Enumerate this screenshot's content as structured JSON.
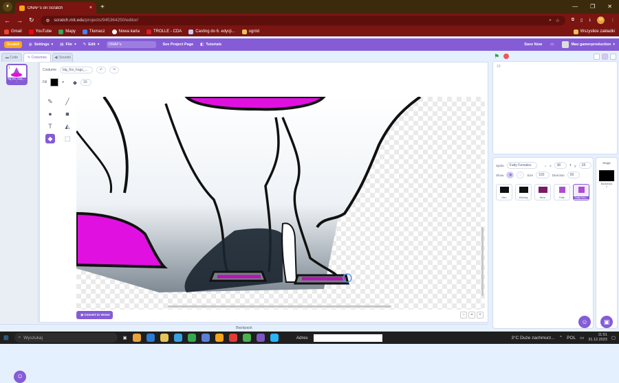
{
  "browser": {
    "tab_title": "ONAF's on Scratch",
    "tab_close": "×",
    "new_tab": "+",
    "win_min": "—",
    "win_max": "❐",
    "win_close": "✕",
    "url_host": "scratch.mit.edu",
    "url_path": "/projects/945364250/editor/",
    "profile_initial": "M",
    "bookmarks": [
      {
        "label": "Gmail"
      },
      {
        "label": "YouTube"
      },
      {
        "label": "Mapy"
      },
      {
        "label": "Tłumacz"
      },
      {
        "label": "Nowa karta"
      },
      {
        "label": "TROLLE - CDA"
      },
      {
        "label": "Casting do 6. edycji..."
      },
      {
        "label": "ogród"
      }
    ],
    "all_bookmarks": "Wszystkie zakładki"
  },
  "scratch": {
    "logo": "Scratch",
    "settings": "Settings",
    "file": "File",
    "edit": "Edit",
    "project_title": "ONAF's",
    "see_project_page": "See Project Page",
    "tutorials": "Tutorials",
    "save_now": "Save Now",
    "username": "Mao gamerproduction"
  },
  "editor": {
    "tabs": [
      {
        "label": "Code"
      },
      {
        "label": "Costumes"
      },
      {
        "label": "Sounds"
      }
    ],
    "costume_label": "Costume",
    "costume_name": "big_fox_hugs_...",
    "fill_label": "Fill",
    "outline_size": "15",
    "convert_button": "Convert to Vector",
    "costumes": [
      {
        "num": "1",
        "name": "big_fox_hugs_...",
        "size": "..."
      }
    ],
    "zoom": {
      "minus": "−",
      "reset": "=",
      "plus": "+"
    }
  },
  "stage": {
    "coords": "10"
  },
  "sprite": {
    "label": "Sprite",
    "name": "Fatty Females",
    "x_label": "x",
    "x": "38",
    "y_label": "y",
    "y": "28",
    "show_label": "Show",
    "size_label": "Size",
    "size": "100",
    "direction_label": "Direction",
    "direction": "90",
    "sprites": [
      {
        "name": "Intro"
      },
      {
        "name": "Warning"
      },
      {
        "name": "Menu"
      },
      {
        "name": "Fatty"
      },
      {
        "name": "Fatty Fem..."
      }
    ]
  },
  "stage_pane": {
    "title": "Stage",
    "backdrops_label": "Backdrops",
    "backdrops_count": "1"
  },
  "backpack": "Backpack",
  "taskbar": {
    "search": "Wyszukaj",
    "address_label": "Adres",
    "weather": "3°C  Duże zachmurz...",
    "lang": "POL",
    "time": "11:51",
    "date": "31.12.2023"
  },
  "colors": {
    "scratch_purple": "#855cd6",
    "browser_red": "#7a1511",
    "magenta": "#e010e0"
  }
}
